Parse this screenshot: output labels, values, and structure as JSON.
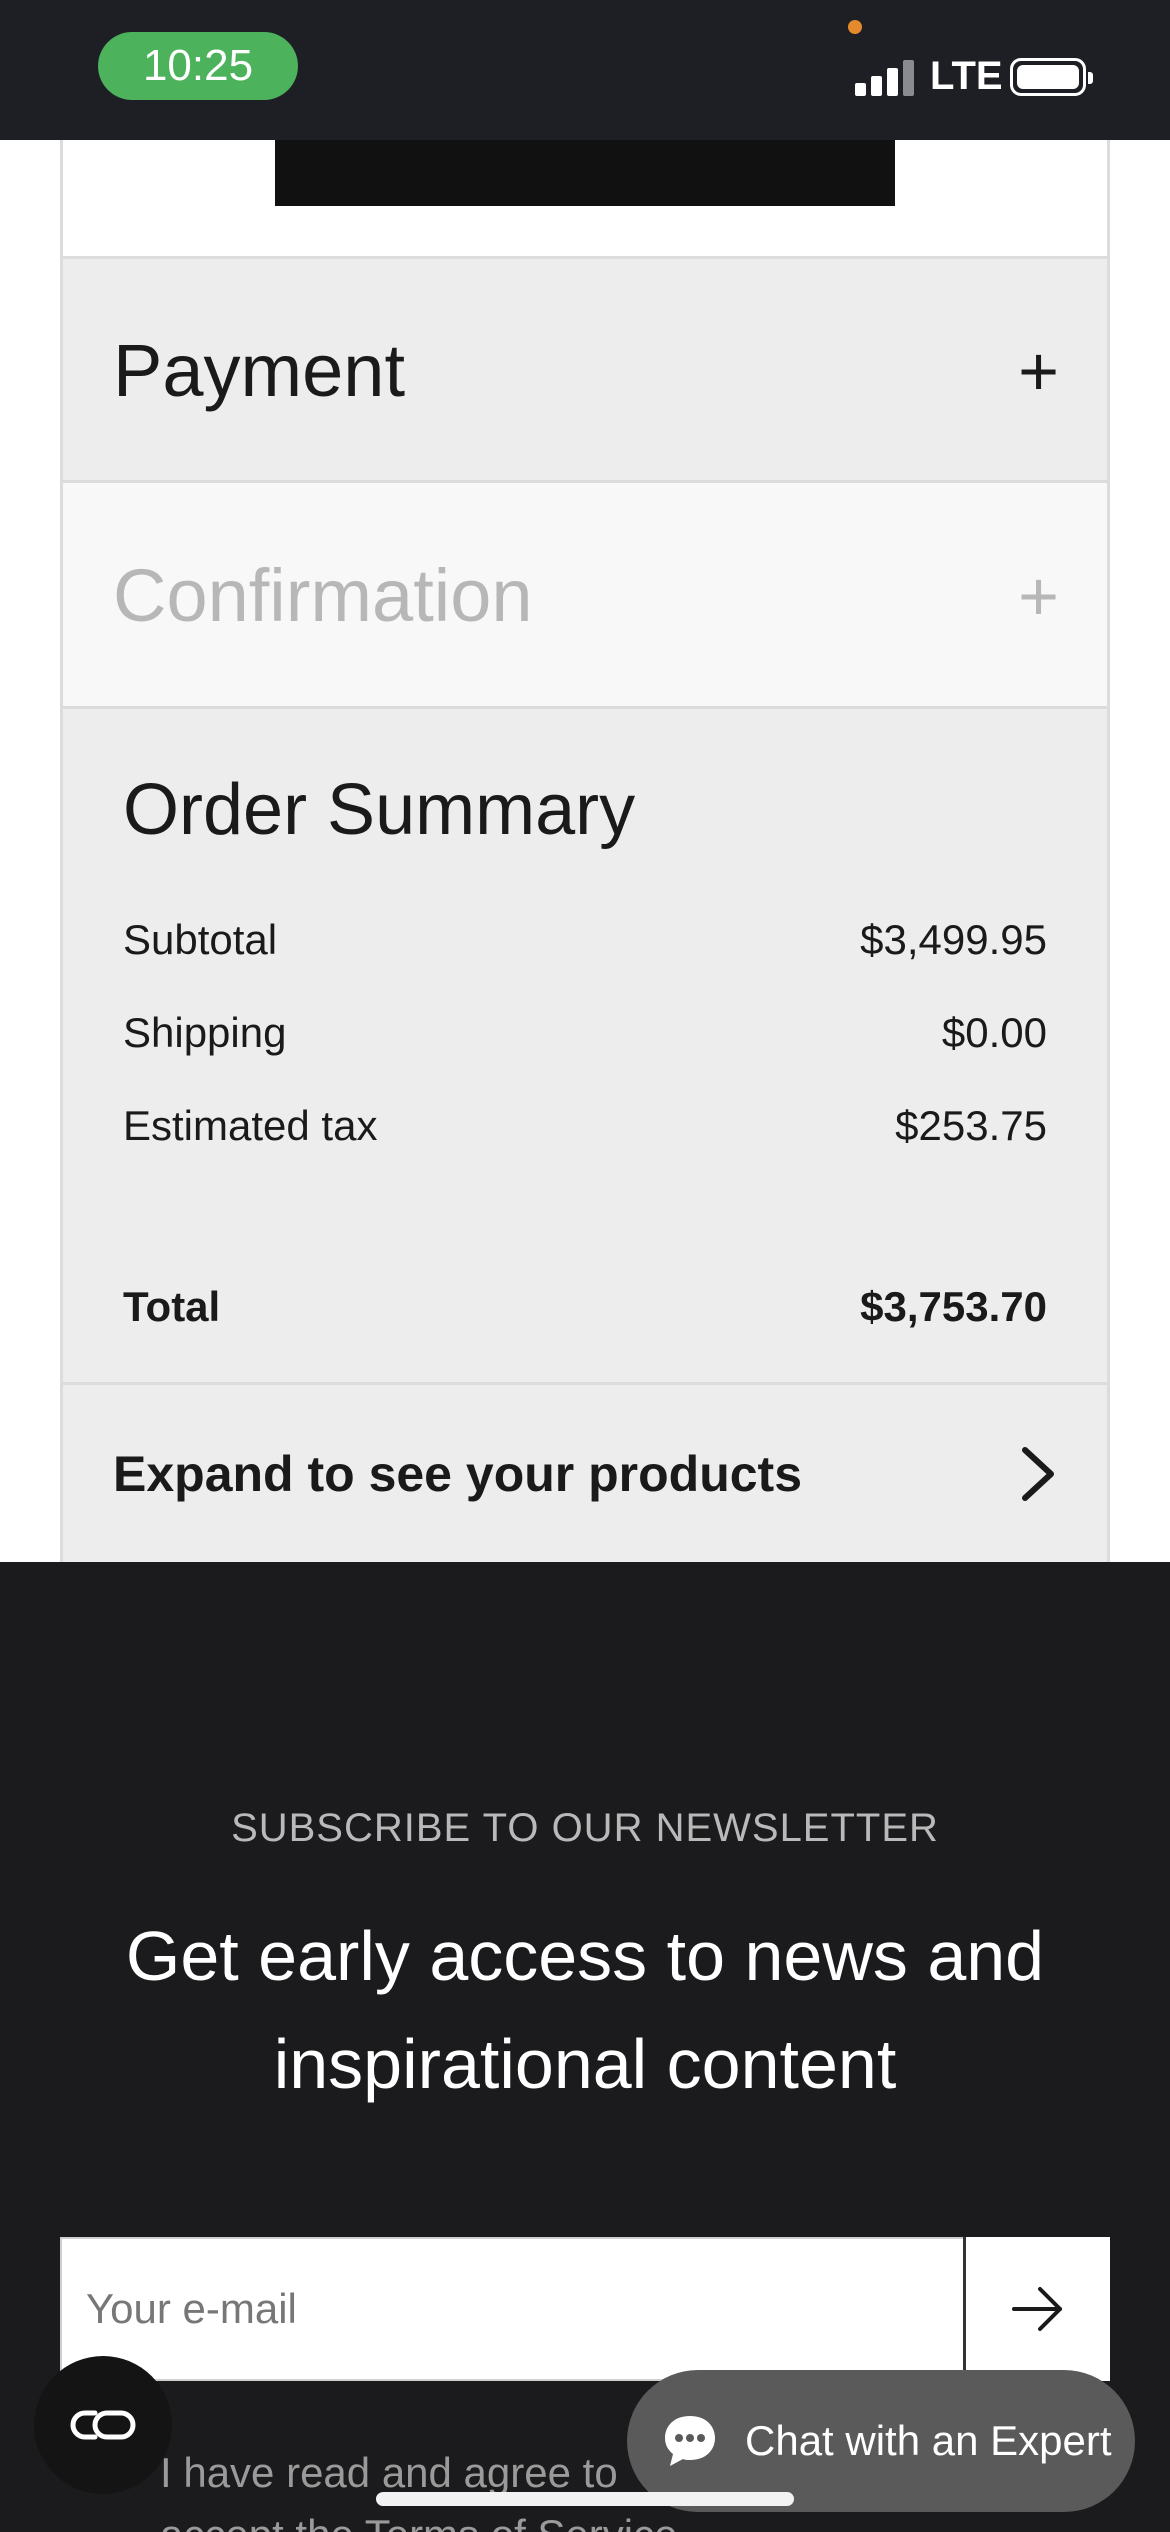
{
  "status_bar": {
    "time": "10:25",
    "network": "LTE"
  },
  "checkout": {
    "payment": {
      "title": "Payment",
      "toggle": "+"
    },
    "confirmation": {
      "title": "Confirmation",
      "toggle": "+"
    }
  },
  "order_summary": {
    "title": "Order Summary",
    "rows": [
      {
        "label": "Subtotal",
        "value": "$3,499.95"
      },
      {
        "label": "Shipping",
        "value": "$0.00"
      },
      {
        "label": "Estimated tax",
        "value": "$253.75"
      }
    ],
    "total": {
      "label": "Total",
      "value": "$3,753.70"
    },
    "expand_label": "Expand to see your products"
  },
  "newsletter": {
    "kicker": "SUBSCRIBE TO OUR NEWSLETTER",
    "headline_line1": "Get early access to news and",
    "headline_line2": "inspirational content",
    "email_placeholder": "Your e-mail",
    "terms_line1": "I have read and agree to",
    "terms_line2": "accept the Terms of Service"
  },
  "chat": {
    "label": "Chat with an Expert"
  },
  "icons": {
    "accordion_toggle": "plus-icon",
    "expand": "chevron-right-icon",
    "submit": "arrow-right-icon",
    "chat": "chat-bubble-icon",
    "loop": "loop-icon"
  },
  "colors": {
    "status_bar_bg": "#1e1f24",
    "time_pill": "#4cb25b",
    "panel_bg": "#ededed",
    "footer_bg": "#1b1b1d",
    "chat_bg": "#5a5a5a"
  }
}
